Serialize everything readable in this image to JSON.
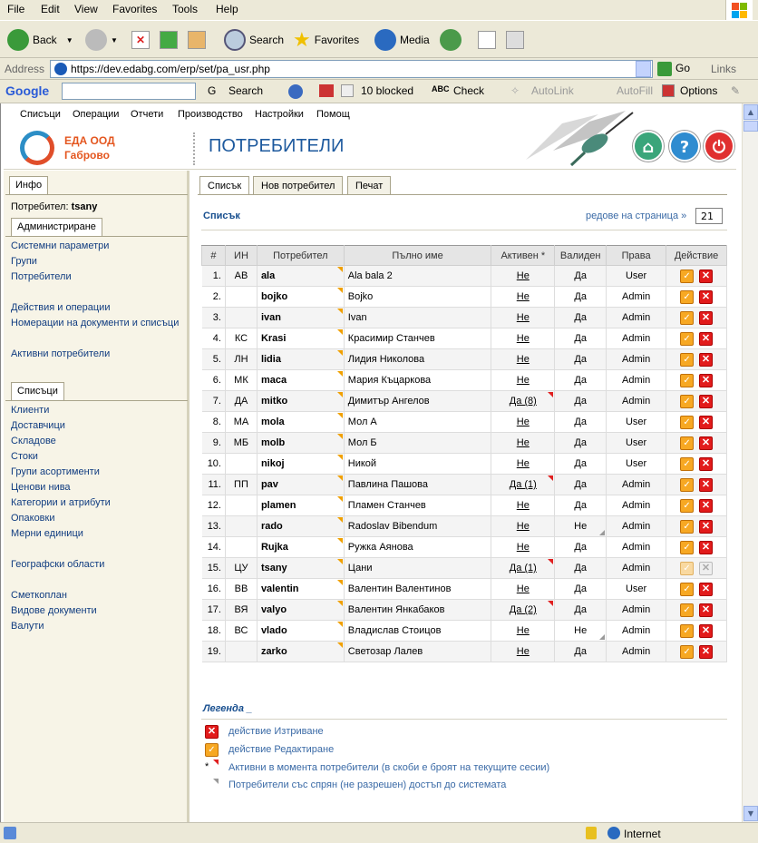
{
  "browser": {
    "menu": [
      "File",
      "Edit",
      "View",
      "Favorites",
      "Tools",
      "Help"
    ],
    "toolbar": {
      "back": "Back",
      "search": "Search",
      "favorites": "Favorites",
      "media": "Media"
    },
    "address_label": "Address",
    "url": "https://dev.edabg.com/erp/set/pa_usr.php",
    "go": "Go",
    "links": "Links",
    "google": {
      "logo": "Google",
      "search": "Search",
      "blocked": "10 blocked",
      "check": "Check",
      "autolink": "AutoLink",
      "autofill": "AutoFill",
      "options": "Options"
    },
    "status": {
      "zone": "Internet"
    }
  },
  "app": {
    "nav": [
      "Списъци",
      "Операции",
      "Отчети",
      "Производство",
      "Настройки",
      "Помощ"
    ],
    "company_line1": "ЕДА ООД",
    "company_line2": "Габрово",
    "page_title": "ПОТРЕБИТЕЛИ",
    "header_icons": [
      "home-icon",
      "help-icon",
      "power-icon"
    ],
    "header_icon_glyphs": [
      "⌂",
      "?",
      "⏻"
    ]
  },
  "sidebar": {
    "info_tab": "Инфо",
    "user_label": "Потребител:",
    "user_name": "tsany",
    "admin_tab": "Администриране",
    "admin_links": [
      "Системни параметри",
      "Групи",
      "Потребители",
      "Действия и операции",
      "Номерации на документи и списъци",
      "Активни потребители"
    ],
    "lists_tab": "Списъци",
    "lists_links": [
      "Клиенти",
      "Доставчици",
      "Складове",
      "Стоки",
      "Групи асортименти",
      "Ценови нива",
      "Категории и атрибути",
      "Опаковки",
      "Мерни единици",
      "Географски области",
      "Сметкоплан",
      "Видове документи",
      "Валути"
    ]
  },
  "main": {
    "tabs": [
      "Списък",
      "Нов потребител",
      "Печат"
    ],
    "list_title": "Списък",
    "rows_per_page_label": "редове на страница »",
    "rows_per_page": "21",
    "columns": [
      "#",
      "ИН",
      "Потребител",
      "Пълно име",
      "Активен *",
      "Валиден",
      "Права",
      "Действие"
    ],
    "rows": [
      {
        "n": "1.",
        "in": "АВ",
        "user": "ala",
        "name": "Ala bala 2",
        "active": "Не",
        "valid": "Да",
        "rights": "User"
      },
      {
        "n": "2.",
        "in": "",
        "user": "bojko",
        "name": "Bojko",
        "active": "Не",
        "valid": "Да",
        "rights": "Admin"
      },
      {
        "n": "3.",
        "in": "",
        "user": "ivan",
        "name": "Ivan",
        "active": "Не",
        "valid": "Да",
        "rights": "Admin"
      },
      {
        "n": "4.",
        "in": "КС",
        "user": "Krasi",
        "name": "Красимир Станчев",
        "active": "Не",
        "valid": "Да",
        "rights": "Admin"
      },
      {
        "n": "5.",
        "in": "ЛН",
        "user": "lidia",
        "name": "Лидия Николова",
        "active": "Не",
        "valid": "Да",
        "rights": "Admin"
      },
      {
        "n": "6.",
        "in": "МК",
        "user": "maca",
        "name": "Мария Къцаркова",
        "active": "Не",
        "valid": "Да",
        "rights": "Admin"
      },
      {
        "n": "7.",
        "in": "ДА",
        "user": "mitko",
        "name": "Димитър Ангелов",
        "active": "Да (8)",
        "valid": "Да",
        "rights": "Admin"
      },
      {
        "n": "8.",
        "in": "МА",
        "user": "mola",
        "name": "Мол А",
        "active": "Не",
        "valid": "Да",
        "rights": "User"
      },
      {
        "n": "9.",
        "in": "МБ",
        "user": "molb",
        "name": "Мол Б",
        "active": "Не",
        "valid": "Да",
        "rights": "User"
      },
      {
        "n": "10.",
        "in": "",
        "user": "nikoj",
        "name": "Никой",
        "active": "Не",
        "valid": "Да",
        "rights": "User"
      },
      {
        "n": "11.",
        "in": "ПП",
        "user": "pav",
        "name": "Павлина Пашова",
        "active": "Да (1)",
        "valid": "Да",
        "rights": "Admin"
      },
      {
        "n": "12.",
        "in": "",
        "user": "plamen",
        "name": "Пламен Станчев",
        "active": "Не",
        "valid": "Да",
        "rights": "Admin"
      },
      {
        "n": "13.",
        "in": "",
        "user": "rado",
        "name": "Radoslav Bibendum",
        "active": "Не",
        "valid": "Не",
        "rights": "Admin"
      },
      {
        "n": "14.",
        "in": "",
        "user": "Rujka",
        "name": "Ружка Аянова",
        "active": "Не",
        "valid": "Да",
        "rights": "Admin"
      },
      {
        "n": "15.",
        "in": "ЦУ",
        "user": "tsany",
        "name": "Цани",
        "active": "Да (1)",
        "valid": "Да",
        "rights": "Admin"
      },
      {
        "n": "16.",
        "in": "ВВ",
        "user": "valentin",
        "name": "Валентин Валентинов",
        "active": "Не",
        "valid": "Да",
        "rights": "User"
      },
      {
        "n": "17.",
        "in": "ВЯ",
        "user": "valyo",
        "name": "Валентин Янкабаков",
        "active": "Да (2)",
        "valid": "Да",
        "rights": "Admin"
      },
      {
        "n": "18.",
        "in": "ВС",
        "user": "vlado",
        "name": "Владислав Стоицов",
        "active": "Не",
        "valid": "Не",
        "rights": "Admin"
      },
      {
        "n": "19.",
        "in": "",
        "user": "zarko",
        "name": "Светозар Лалев",
        "active": "Не",
        "valid": "Да",
        "rights": "Admin"
      }
    ],
    "legend_title": "Легенда _",
    "legend": [
      "действие Изтриване",
      "действие Редактиране",
      "Активни в момента потребители (в скоби е броят на текущите сесии)",
      "Потребители със спрян (не разрешен) достъп до системата"
    ],
    "legend_star": "*"
  },
  "colors": {
    "title": "#1e5a9e",
    "company": "#e4561f",
    "link": "#103c80",
    "edit": "#f7a823",
    "delete": "#e21b1b"
  }
}
